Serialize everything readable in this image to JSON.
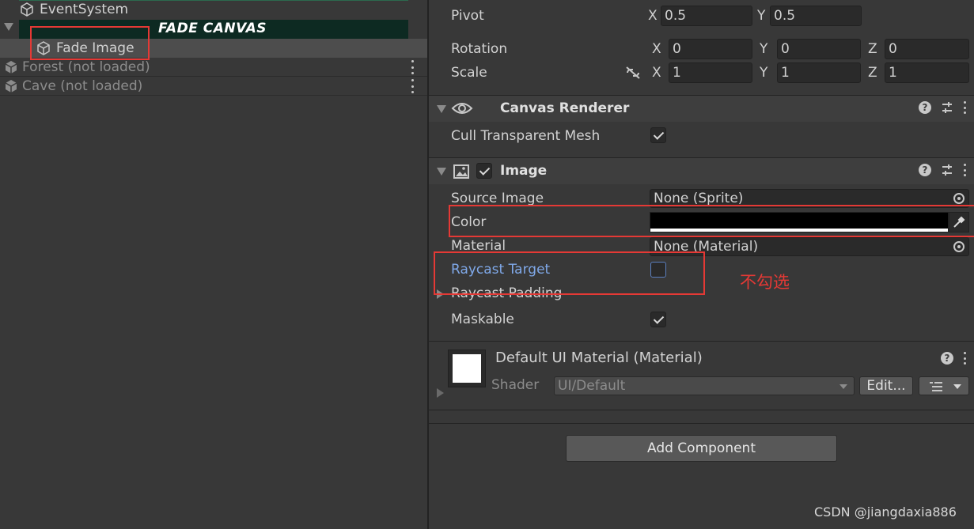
{
  "hierarchy": {
    "event_system": "EventSystem",
    "fade_canvas": "FADE CANVAS",
    "fade_image": "Fade Image",
    "forest": "Forest (not loaded)",
    "cave": "Cave (not loaded)"
  },
  "transform": {
    "pivot_label": "Pivot",
    "pivot_x": "0.5",
    "pivot_y": "0.5",
    "rotation_label": "Rotation",
    "rotation_x": "0",
    "rotation_y": "0",
    "rotation_z": "0",
    "scale_label": "Scale",
    "scale_x": "1",
    "scale_y": "1",
    "scale_z": "1",
    "axis_x": "X",
    "axis_y": "Y",
    "axis_z": "Z"
  },
  "canvas_renderer": {
    "title": "Canvas Renderer",
    "cull_label": "Cull Transparent Mesh",
    "cull_checked": true
  },
  "image": {
    "title": "Image",
    "enabled": true,
    "source_image_label": "Source Image",
    "source_image_value": "None (Sprite)",
    "color_label": "Color",
    "color_value": "#000000",
    "material_label": "Material",
    "material_value": "None (Material)",
    "raycast_target_label": "Raycast Target",
    "raycast_target_checked": false,
    "raycast_padding_label": "Raycast Padding",
    "maskable_label": "Maskable",
    "maskable_checked": true
  },
  "material": {
    "title": "Default UI Material (Material)",
    "shader_label": "Shader",
    "shader_value": "UI/Default",
    "edit_label": "Edit..."
  },
  "add_component_label": "Add Component",
  "annotation": "不勾选",
  "watermark": "CSDN @jiangdaxia886",
  "colors": {
    "highlight_box": "#e53935",
    "raycast_label": "#7fa8e8",
    "fade_canvas_bg": "#0d2a22"
  }
}
